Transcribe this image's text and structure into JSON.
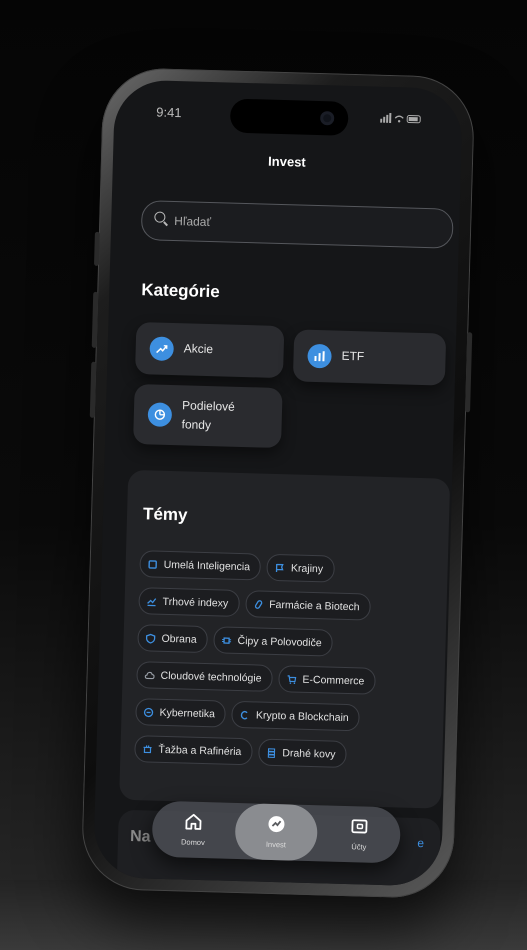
{
  "status": {
    "time": "9:41"
  },
  "header": {
    "title": "Invest"
  },
  "search": {
    "placeholder": "Hľadať"
  },
  "categories": {
    "title": "Kategórie",
    "items": [
      {
        "label": "Akcie",
        "icon": "chart-up-icon"
      },
      {
        "label": "ETF",
        "icon": "bar-chart-icon"
      },
      {
        "label": "Podielové fondy",
        "icon": "pie-chart-icon"
      }
    ]
  },
  "themes": {
    "title": "Témy",
    "chips": [
      {
        "label": "Umelá Inteligencia",
        "icon": "chip-ai-icon"
      },
      {
        "label": "Krajiny",
        "icon": "flag-icon"
      },
      {
        "label": "Trhové indexy",
        "icon": "index-chart-icon"
      },
      {
        "label": "Farmácie a Biotech",
        "icon": "pharma-icon"
      },
      {
        "label": "Obrana",
        "icon": "shield-icon"
      },
      {
        "label": "Čipy a Polovodiče",
        "icon": "semiconductor-icon"
      },
      {
        "label": "Cloudové technológie",
        "icon": "cloud-icon"
      },
      {
        "label": "E-Commerce",
        "icon": "cart-icon"
      },
      {
        "label": "Kybernetika",
        "icon": "cyber-icon"
      },
      {
        "label": "Krypto a Blockchain",
        "icon": "crypto-icon"
      },
      {
        "label": "Ťažba a Rafinéria",
        "icon": "mining-icon"
      },
      {
        "label": "Drahé kovy",
        "icon": "gold-bars-icon"
      }
    ]
  },
  "peek": {
    "title": "Na",
    "link": "e"
  },
  "tabbar": {
    "tabs": [
      {
        "label": "Domov",
        "icon": "home-icon"
      },
      {
        "label": "Invest",
        "icon": "invest-icon",
        "active": true
      },
      {
        "label": "Účty",
        "icon": "wallet-icon"
      }
    ]
  },
  "colors": {
    "accent": "#3d8fe0",
    "screen_bg": "#151618",
    "card_bg": "#2a2b2f"
  }
}
